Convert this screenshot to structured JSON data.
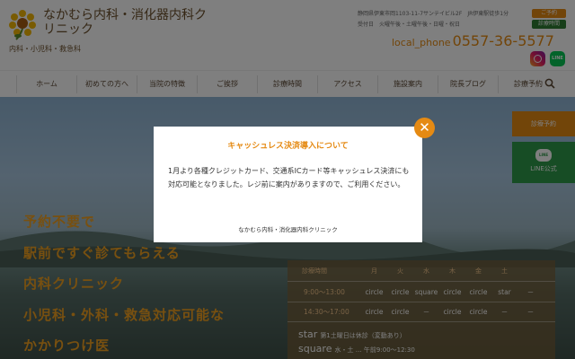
{
  "header": {
    "clinic_name": "なかむら内科・消化器内科クリニック",
    "clinic_sub": "内科・小児科・救急科",
    "address": "静岡県伊東市岡1103-11-7サンテイビル2F　JR伊東駅徒歩1分",
    "hours_info": "受付日　火曜午後・土曜午後・日曜・祝日",
    "button_top": "ご予約",
    "button_bottom": "診療時間",
    "phone_label": "local_phone",
    "phone_number": "0557-36-5577"
  },
  "nav": {
    "items": [
      "ホーム",
      "初めての方へ",
      "当院の特徴",
      "ご挨拶",
      "診療時間",
      "アクセス",
      "施設案内",
      "院長ブログ",
      "診療予約"
    ]
  },
  "hero": {
    "slogans": [
      "予約不要で",
      "駅前ですぐ診てもらえる",
      "内科クリニック",
      "小児科・外科・救急対応可能な",
      "かかりつけ医"
    ]
  },
  "side": {
    "reserve_label": "診療予約",
    "line_icon_text": "LINE",
    "line_label": "LINE公式"
  },
  "schedule": {
    "header_label": "診療時間",
    "days": [
      "月",
      "火",
      "水",
      "木",
      "金",
      "土"
    ],
    "rows": [
      {
        "time": "9:00～13:00",
        "cells": [
          "circle",
          "circle",
          "square",
          "circle",
          "circle",
          "star"
        ],
        "tail": "－"
      },
      {
        "time": "14:30～17:00",
        "cells": [
          "circle",
          "circle",
          "－",
          "circle",
          "circle",
          "－"
        ],
        "tail": "－"
      }
    ],
    "note1_key": "star",
    "note1_text": "第1土曜日は休診（変動あり）",
    "note2_key": "square",
    "note2_text": "水・土 … 午前9:00～12:30"
  },
  "modal": {
    "title": "キャッシュレス決済導入について",
    "body": "1月より各種クレジットカード、交通系ICカード等キャッシュレス決済にも対応可能となりました。レジ前に案内がありますので、ご利用ください。",
    "signature": "なかむら内科・消化器内科クリニック",
    "close_symbol": "✕"
  }
}
